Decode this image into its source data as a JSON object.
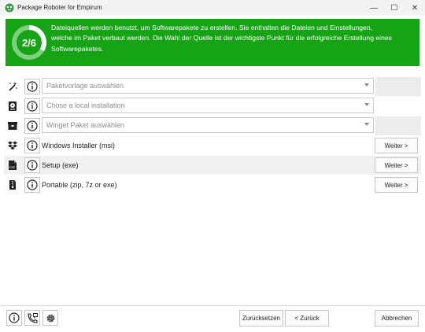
{
  "window": {
    "title": "Package Roboter for Empirum",
    "controls": {
      "minimize": "—",
      "maximize": "☐",
      "close": "✕"
    }
  },
  "banner": {
    "progress_label": "2/6",
    "progress_fraction": 0.333,
    "line1": "Dateiquellen werden benutzt, um Softwarepakete zu erstellen. Sie enthalten die Dateien und Einstellungen,",
    "line2": "welche im Paket verbaut werden. Die Wahl der Quelle ist der wichtigste Punkt für die erfolgreiche Erstellung eines",
    "line3": "Softwarepaketes.",
    "color": "#16a316"
  },
  "sources": {
    "template_select": {
      "icon": "magic-wand-icon",
      "placeholder": "Paketvorlage auswählen"
    },
    "local_install_select": {
      "icon": "disk-icon",
      "placeholder": "Chose a local installation"
    },
    "winget_select": {
      "icon": "package-box-icon",
      "placeholder": "Winget Paket auswählen"
    },
    "msi": {
      "icon": "dropbox-icon",
      "label": "Windows Installer (msi)",
      "button": "Weiter >"
    },
    "exe": {
      "icon": "exe-file-icon",
      "label": "Setup (exe)",
      "button": "Weiter >"
    },
    "portable": {
      "icon": "zip-file-icon",
      "label": "Portable (zip, 7z or exe)",
      "button": "Weiter >"
    }
  },
  "footer": {
    "reset": "Zurücksetzen",
    "back": "< Zurück",
    "cancel": "Abbrechen"
  }
}
